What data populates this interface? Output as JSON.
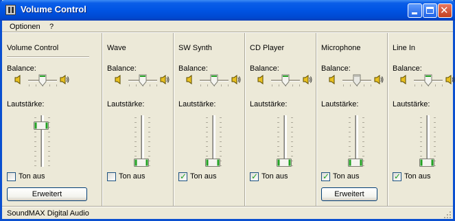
{
  "window": {
    "title": "Volume Control",
    "icon": "volume-app-icon"
  },
  "menu": [
    "Optionen",
    "?"
  ],
  "balance_label": "Balance:",
  "volume_label": "Lautstärke:",
  "mute_label": "Ton aus",
  "advanced_label": "Erweitert",
  "channels": [
    {
      "name": "Volume Control",
      "balance": 0.5,
      "volume": 0.85,
      "muted": false,
      "advanced": true
    },
    {
      "name": "Wave",
      "balance": 0.5,
      "volume": 0.0,
      "muted": false,
      "advanced": false
    },
    {
      "name": "SW Synth",
      "balance": 0.5,
      "volume": 0.0,
      "muted": true,
      "advanced": false
    },
    {
      "name": "CD Player",
      "balance": 0.5,
      "volume": 0.0,
      "muted": true,
      "advanced": false
    },
    {
      "name": "Microphone",
      "balance": 0.5,
      "volume": 0.0,
      "muted": true,
      "advanced": true,
      "disabled_balance": true
    },
    {
      "name": "Line In",
      "balance": 0.5,
      "volume": 0.0,
      "muted": true,
      "advanced": false
    }
  ],
  "status": "SoundMAX Digital Audio",
  "colors": {
    "title_blue": "#0054e3",
    "face": "#ece9d8",
    "thumb_green": "#21a121"
  }
}
